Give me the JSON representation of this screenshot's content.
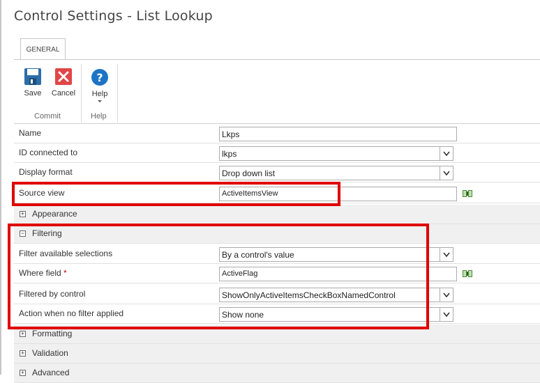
{
  "window": {
    "title": "Control Settings - List Lookup"
  },
  "ribbon": {
    "tab_general": "GENERAL",
    "save_label": "Save",
    "cancel_label": "Cancel",
    "help_label": "Help",
    "commit_group": "Commit",
    "help_group": "Help"
  },
  "fields": {
    "name": {
      "label": "Name",
      "value": "Lkps"
    },
    "id_connected": {
      "label": "ID connected to",
      "value": "lkps"
    },
    "display_format": {
      "label": "Display format",
      "value": "Drop down list"
    },
    "source_view": {
      "label": "Source view",
      "value": "ActiveItemsView"
    }
  },
  "sections": {
    "appearance": {
      "label": "Appearance",
      "toggle": "+"
    },
    "filtering": {
      "label": "Filtering",
      "toggle": "−"
    },
    "formatting": {
      "label": "Formatting",
      "toggle": "+"
    },
    "validation": {
      "label": "Validation",
      "toggle": "+"
    },
    "advanced": {
      "label": "Advanced",
      "toggle": "+"
    }
  },
  "filtering": {
    "filter_available": {
      "label": "Filter available selections",
      "value": "By a control's value"
    },
    "where_field": {
      "label": "Where field",
      "required": "*",
      "value": "ActiveFlag"
    },
    "filtered_by": {
      "label": "Filtered by control",
      "value": "ShowOnlyActiveItemsCheckBoxNamedControl"
    },
    "no_filter_action": {
      "label": "Action when no filter applied",
      "value": "Show none"
    }
  },
  "colors": {
    "highlight": "#e00000",
    "save_blue": "#2e6ea6",
    "cancel_red": "#e04646",
    "help_blue": "#1e74c4"
  }
}
